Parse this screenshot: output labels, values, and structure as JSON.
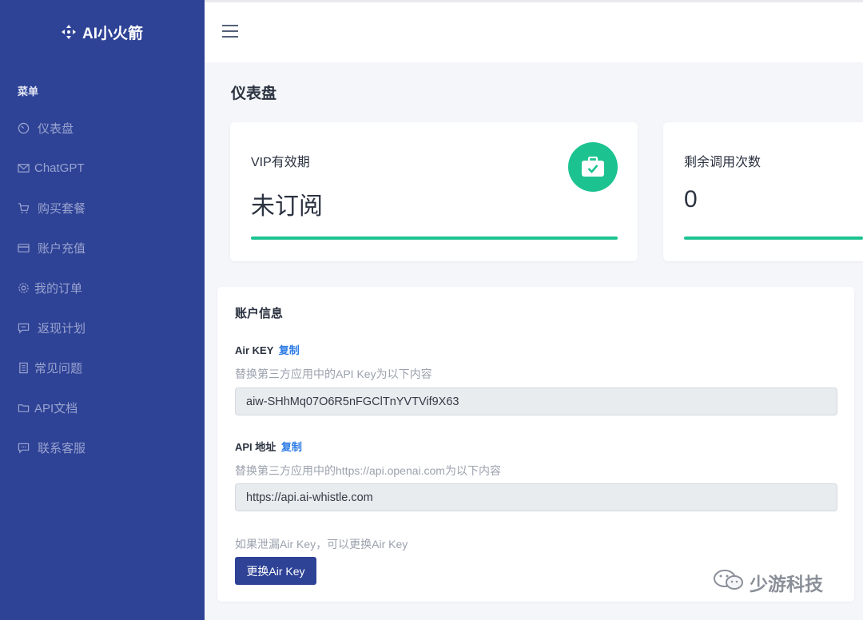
{
  "brand": {
    "name": "AI小火箭",
    "icon": "move-arrows-icon"
  },
  "sidebar": {
    "heading": "菜单",
    "items": [
      {
        "label": "仪表盘",
        "icon": "dashboard-icon"
      },
      {
        "label": "ChatGPT",
        "icon": "envelope-icon"
      },
      {
        "label": "购买套餐",
        "icon": "cart-icon"
      },
      {
        "label": "账户充值",
        "icon": "credit-card-icon"
      },
      {
        "label": "我的订单",
        "icon": "gear-icon"
      },
      {
        "label": "返现计划",
        "icon": "comment-icon"
      },
      {
        "label": "常见问题",
        "icon": "document-icon"
      },
      {
        "label": "API文档",
        "icon": "folder-icon"
      },
      {
        "label": "联系客服",
        "icon": "chat-icon"
      }
    ]
  },
  "header": {
    "menu_icon": "hamburger-icon"
  },
  "page": {
    "title": "仪表盘"
  },
  "stats": [
    {
      "label": "VIP有效期",
      "value": "未订阅",
      "icon": "briefcase-check-icon",
      "progress": 1.0
    },
    {
      "label": "剩余调用次数",
      "value": "0",
      "progress": 1.0
    }
  ],
  "account": {
    "title": "账户信息",
    "key_label": "Air KEY",
    "key_copy": "复制",
    "key_hint": "替换第三方应用中的API Key为以下内容",
    "key_value": "aiw-SHhMq07O6R5nFGClTnYVTVif9X63",
    "url_label": "API 地址",
    "url_copy": "复制",
    "url_hint": "替换第三方应用中的https://api.openai.com为以下内容",
    "url_value": "https://api.ai-whistle.com",
    "leak_hint": "如果泄漏Air Key，可以更换Air Key",
    "change_button": "更换Air Key"
  },
  "watermark": {
    "text": "少游科技",
    "icon": "wechat-icon"
  },
  "colors": {
    "sidebar": "#2e4296",
    "accent": "#1cc391",
    "link": "#2c7be5"
  }
}
